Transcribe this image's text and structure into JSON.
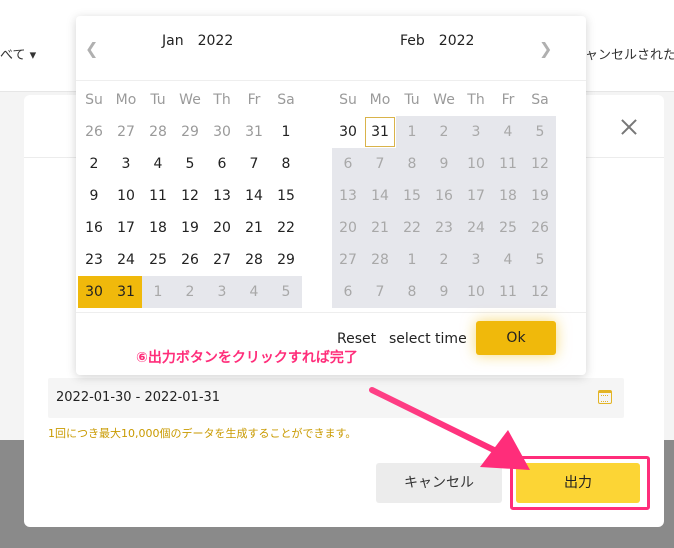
{
  "background": {
    "filter_label": "べて ▾",
    "tab_label": "ャンセルされた注"
  },
  "picker": {
    "left": {
      "month": "Jan",
      "year": "2022"
    },
    "right": {
      "month": "Feb",
      "year": "2022"
    },
    "weekdays": [
      "Su",
      "Mo",
      "Tu",
      "We",
      "Th",
      "Fr",
      "Sa"
    ],
    "prev_icon": "chevron-left-icon",
    "next_icon": "chevron-right-icon",
    "jan_weeks": [
      [
        "26",
        "27",
        "28",
        "29",
        "30",
        "31",
        "1"
      ],
      [
        "2",
        "3",
        "4",
        "5",
        "6",
        "7",
        "8"
      ],
      [
        "9",
        "10",
        "11",
        "12",
        "13",
        "14",
        "15"
      ],
      [
        "16",
        "17",
        "18",
        "19",
        "20",
        "21",
        "22"
      ],
      [
        "23",
        "24",
        "25",
        "26",
        "27",
        "28",
        "29"
      ],
      [
        "30",
        "31",
        "1",
        "2",
        "3",
        "4",
        "5"
      ]
    ],
    "feb_weeks": [
      [
        "30",
        "31",
        "1",
        "2",
        "3",
        "4",
        "5"
      ],
      [
        "6",
        "7",
        "8",
        "9",
        "10",
        "11",
        "12"
      ],
      [
        "13",
        "14",
        "15",
        "16",
        "17",
        "18",
        "19"
      ],
      [
        "20",
        "21",
        "22",
        "23",
        "24",
        "25",
        "26"
      ],
      [
        "27",
        "28",
        "1",
        "2",
        "3",
        "4",
        "5"
      ],
      [
        "6",
        "7",
        "8",
        "9",
        "10",
        "11",
        "12"
      ]
    ],
    "reset_label": "Reset",
    "select_time_label": "select time",
    "ok_label": "Ok"
  },
  "modal": {
    "close_icon": "close-icon",
    "date_range_value": "2022-01-30 - 2022-01-31",
    "calendar_icon": "calendar-icon",
    "note": "1回につき最大10,000個のデータを生成することができます。",
    "cancel_label": "キャンセル",
    "output_label": "出力"
  },
  "annotation": {
    "text": "⑥出力ボタンをクリックすれば完了",
    "color": "#ff2d7a"
  },
  "colors": {
    "accent": "#f0b90b",
    "output_button": "#fcd535"
  }
}
